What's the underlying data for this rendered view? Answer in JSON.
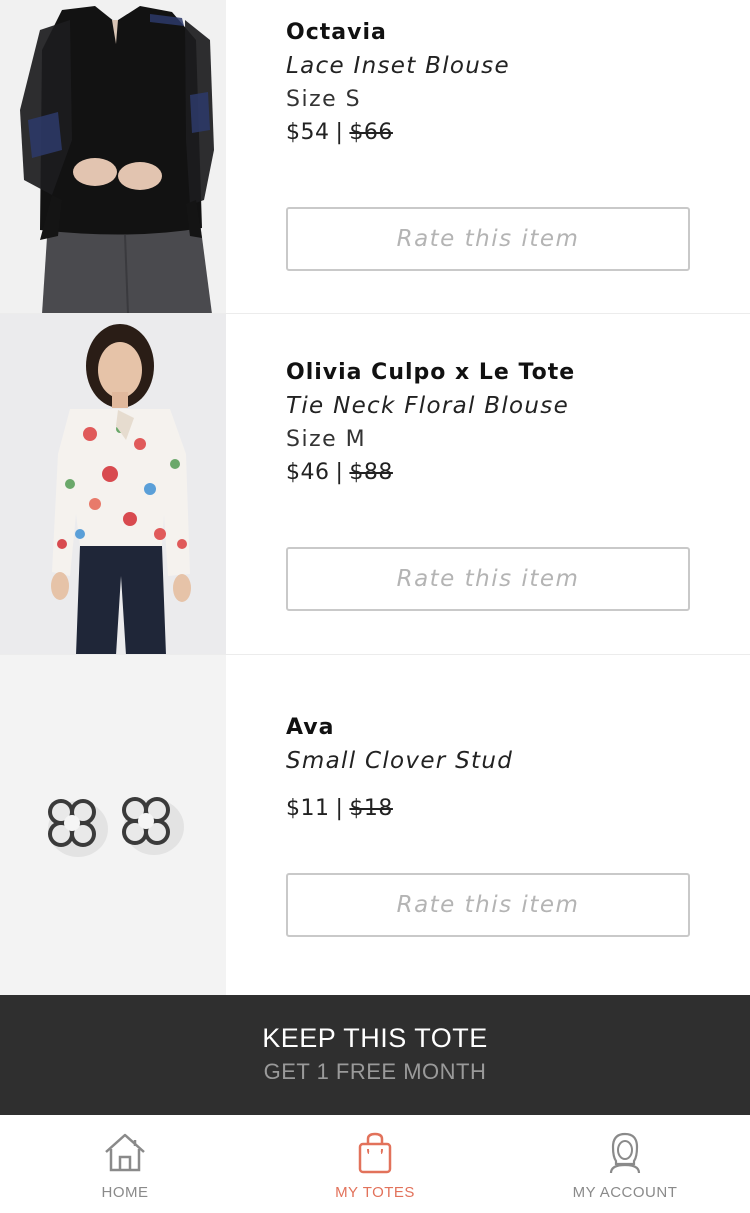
{
  "items": [
    {
      "brand": "Octavia",
      "name": "Lace Inset Blouse",
      "size": "Size S",
      "price": "$54",
      "separator": "|",
      "original_price": "$66",
      "rate_label": "Rate this item"
    },
    {
      "brand": "Olivia Culpo x Le Tote",
      "name": "Tie Neck Floral Blouse",
      "size": "Size M",
      "price": "$46",
      "separator": "|",
      "original_price": "$88",
      "rate_label": "Rate this item"
    },
    {
      "brand": "Ava",
      "name": "Small Clover Stud",
      "price": "$11",
      "separator": "|",
      "original_price": "$18",
      "rate_label": "Rate this item"
    }
  ],
  "keep_tote": {
    "title": "KEEP THIS TOTE",
    "subtitle": "GET 1 FREE MONTH"
  },
  "tabs": [
    {
      "label": "HOME",
      "icon": "home-icon"
    },
    {
      "label": "MY TOTES",
      "icon": "shopping-bag-icon"
    },
    {
      "label": "MY ACCOUNT",
      "icon": "account-icon"
    }
  ],
  "colors": {
    "accent": "#e2725b",
    "bar_background": "#2f2f2f",
    "button_border": "#c9c9c9",
    "placeholder_text": "#b4b4b4"
  }
}
